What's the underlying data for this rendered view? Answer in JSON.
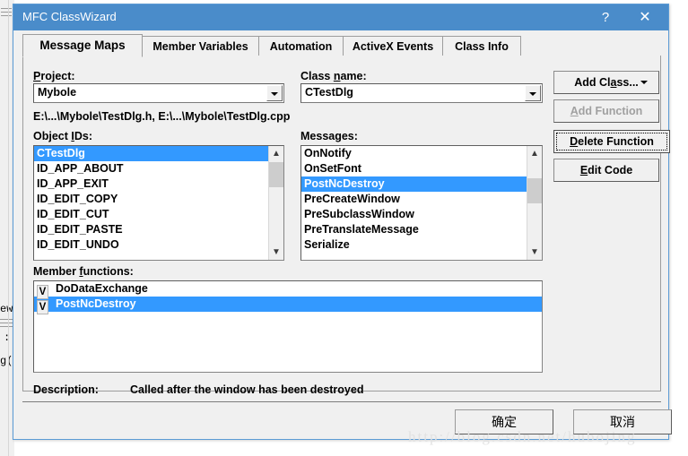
{
  "window": {
    "title": "MFC ClassWizard",
    "help_icon": "?",
    "close_icon": "✕"
  },
  "tabs": [
    {
      "label": "Message Maps",
      "active": true
    },
    {
      "label": "Member Variables",
      "active": false
    },
    {
      "label": "Automation",
      "active": false
    },
    {
      "label": "ActiveX Events",
      "active": false
    },
    {
      "label": "Class Info",
      "active": false
    }
  ],
  "fields": {
    "project_label_pre": "",
    "project_label_accel": "P",
    "project_label_post": "roject:",
    "project_value": "Mybole",
    "class_label_pre": "Class ",
    "class_label_accel": "n",
    "class_label_post": "ame:",
    "class_value": "CTestDlg",
    "file_path": "E:\\...\\Mybole\\TestDlg.h, E:\\...\\Mybole\\TestDlg.cpp",
    "object_ids_label_pre": "Object ",
    "object_ids_label_accel": "I",
    "object_ids_label_post": "Ds:",
    "messages_label": "Messages:",
    "member_functions_label_pre": "Member ",
    "member_functions_label_accel": "f",
    "member_functions_label_post": "unctions:"
  },
  "object_ids": [
    {
      "label": "CTestDlg",
      "selected": true
    },
    {
      "label": "ID_APP_ABOUT",
      "selected": false
    },
    {
      "label": "ID_APP_EXIT",
      "selected": false
    },
    {
      "label": "ID_EDIT_COPY",
      "selected": false
    },
    {
      "label": "ID_EDIT_CUT",
      "selected": false
    },
    {
      "label": "ID_EDIT_PASTE",
      "selected": false
    },
    {
      "label": "ID_EDIT_UNDO",
      "selected": false
    }
  ],
  "messages": [
    {
      "label": "OnNotify",
      "selected": false
    },
    {
      "label": "OnSetFont",
      "selected": false
    },
    {
      "label": "PostNcDestroy",
      "selected": true
    },
    {
      "label": "PreCreateWindow",
      "selected": false
    },
    {
      "label": "PreSubclassWindow",
      "selected": false
    },
    {
      "label": "PreTranslateMessage",
      "selected": false
    },
    {
      "label": "Serialize",
      "selected": false
    }
  ],
  "member_functions": [
    {
      "mark": "V",
      "label": "DoDataExchange",
      "selected": false
    },
    {
      "mark": "V",
      "label": "PostNcDestroy",
      "selected": true
    }
  ],
  "side_buttons": {
    "add_class": {
      "pre": "Add Cl",
      "accel": "a",
      "post": "ss...",
      "has_dropdown": true,
      "disabled": false,
      "focused": false
    },
    "add_function": {
      "pre": "",
      "accel": "A",
      "post": "dd Function",
      "has_dropdown": false,
      "disabled": true,
      "focused": false
    },
    "delete_function": {
      "pre": "",
      "accel": "D",
      "post": "elete Function",
      "has_dropdown": false,
      "disabled": false,
      "focused": true
    },
    "edit_code": {
      "pre": "",
      "accel": "E",
      "post": "dit Code",
      "has_dropdown": false,
      "disabled": false,
      "focused": false
    }
  },
  "description": {
    "label": "Description:",
    "text": "Called after the window has been destroyed"
  },
  "bottom_buttons": {
    "ok": "确定",
    "cancel": "取消"
  },
  "watermark": "http://blog.csdn.net/hubojing",
  "background_fragments": {
    "frag1": "ew",
    "frag2": ":",
    "frag3": "g("
  },
  "colors": {
    "titlebar": "#4a8cca",
    "selection": "#3399ff",
    "dialog_face": "#f0f0f0",
    "dialog_border": "#5b9bd5"
  }
}
